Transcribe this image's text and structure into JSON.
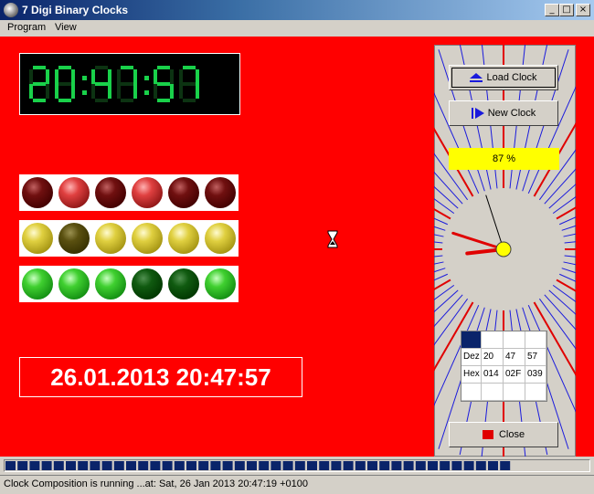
{
  "window": {
    "title": "7 Digi Binary Clocks"
  },
  "menu": {
    "program": "Program",
    "view": "View"
  },
  "led": {
    "time": "20:47:57",
    "color": "#19d14a"
  },
  "binary_balls": {
    "red_row": [
      "off",
      "on",
      "off",
      "on",
      "off",
      "off"
    ],
    "yellow_row": [
      "on",
      "off",
      "on",
      "on",
      "on",
      "on"
    ],
    "green_row": [
      "on",
      "on",
      "on",
      "off",
      "off",
      "on"
    ]
  },
  "datetime": {
    "text": "26.01.2013 20:47:57"
  },
  "panel": {
    "load_clock": "Load Clock",
    "new_clock": "New Clock",
    "percent_label": "87 %",
    "close": "Close"
  },
  "analog_clock": {
    "hours": 20,
    "minutes": 47,
    "seconds": 57
  },
  "conversion_table": {
    "rows": [
      [
        "",
        "",
        "",
        ""
      ],
      [
        "Dez",
        "20",
        "47",
        "57"
      ],
      [
        "Hex",
        "014",
        "02F",
        "039"
      ],
      [
        "",
        "",
        "",
        ""
      ]
    ]
  },
  "bottom_progress": {
    "segments_filled": 42
  },
  "status": {
    "text": "Clock Composition is running ...at: Sat, 26 Jan 2013 20:47:19 +0100"
  },
  "colors": {
    "background": "#ff0000",
    "accent": "#0a246a"
  }
}
